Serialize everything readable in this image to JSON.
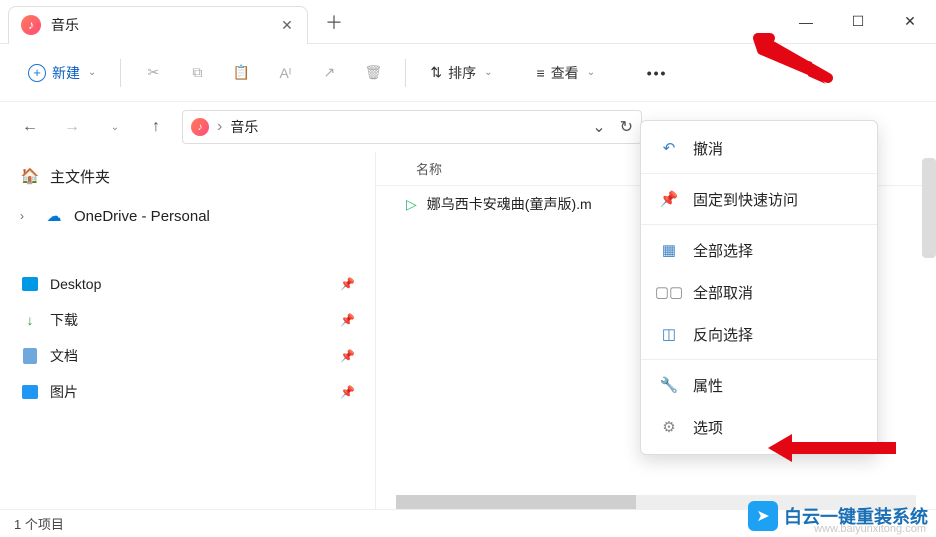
{
  "tab": {
    "title": "音乐"
  },
  "toolbar": {
    "new_label": "新建",
    "sort_label": "排序",
    "view_label": "查看"
  },
  "breadcrumb": {
    "part1": "音乐"
  },
  "sidebar": {
    "home": "主文件夹",
    "onedrive": "OneDrive - Personal",
    "desktop": "Desktop",
    "downloads": "下载",
    "documents": "文档",
    "pictures": "图片"
  },
  "filelist": {
    "col_name": "名称",
    "items": [
      {
        "name": "娜乌西卡安魂曲(童声版).m"
      }
    ]
  },
  "ctx": {
    "undo": "撤消",
    "pin": "固定到快速访问",
    "select_all": "全部选择",
    "deselect_all": "全部取消",
    "invert": "反向选择",
    "properties": "属性",
    "options": "选项"
  },
  "status": {
    "count": "1 个项目"
  },
  "watermark": {
    "text": "白云一键重装系统",
    "url": "www.baiyunxitong.com"
  }
}
